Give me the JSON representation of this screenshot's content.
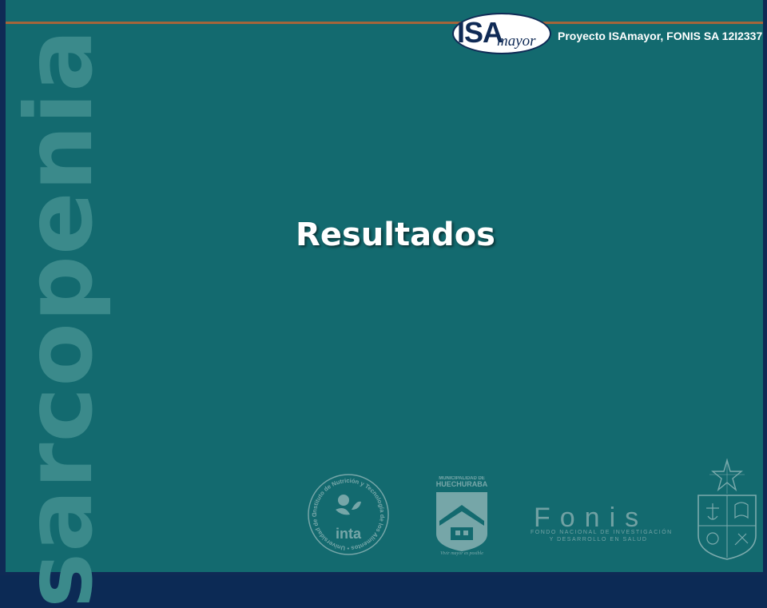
{
  "header": {
    "logo": {
      "main": "ISA",
      "suffix": "mayor"
    },
    "project_title": "Proyecto ISAmayor, FONIS SA 12I2337"
  },
  "sidebar": {
    "vertical_word": "sarcopenia"
  },
  "main": {
    "title": "Resultados"
  },
  "footer": {
    "logos": [
      {
        "name": "inta",
        "arc_text": "Instituto de Nutrición y Tecnología de los Alimentos • Universidad de Chile •",
        "label": "inta"
      },
      {
        "name": "huechuraba",
        "top_text": "MUNICIPALIDAD DE",
        "name_text": "HUECHURABA",
        "tagline": "Vivir mayor es posible"
      },
      {
        "name": "fonis",
        "word": "Fonis",
        "line1": "FONDO NACIONAL DE INVESTIGACIÓN",
        "line2": "Y DESARROLLO EN SALUD"
      },
      {
        "name": "universidad-de-chile"
      }
    ]
  },
  "colors": {
    "background": "#136a6f",
    "frame": "#0f2a55",
    "accent_rule": "#a5653a",
    "title_text": "#ffffff",
    "vertical_word": "#3b8a8b"
  }
}
